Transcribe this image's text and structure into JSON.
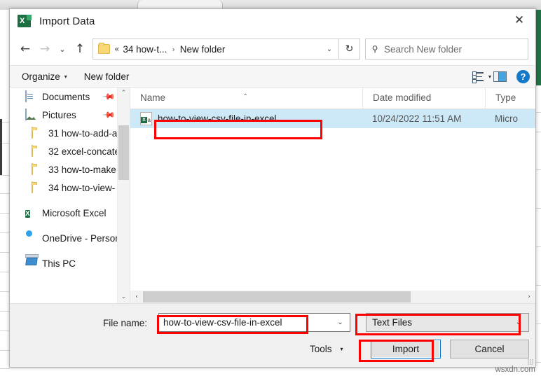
{
  "window": {
    "title": "Import Data",
    "app_icon": "excel-icon",
    "close_label": "✕"
  },
  "nav": {
    "back": "←",
    "forward": "→",
    "recent": "⌄",
    "up": "↑",
    "refresh": "↻",
    "address": {
      "overflow": "«",
      "segments": [
        "34 how-t...",
        "New folder"
      ],
      "separator": "›",
      "dropdown": "⌄"
    },
    "search": {
      "icon": "search-icon",
      "placeholder": "Search New folder"
    }
  },
  "toolbar": {
    "organize": "Organize",
    "organize_caret": "▾",
    "new_folder": "New folder",
    "view_caret": "▾",
    "help": "?"
  },
  "sidebar": {
    "scroll_up": "⌃",
    "scroll_down": "⌄",
    "items": [
      {
        "label": "Documents",
        "icon": "documents-icon",
        "pinned": true,
        "indent": false
      },
      {
        "label": "Pictures",
        "icon": "pictures-icon",
        "pinned": true,
        "indent": false
      },
      {
        "label": "31 how-to-add-a",
        "icon": "folder-icon",
        "pinned": false,
        "indent": true
      },
      {
        "label": "32 excel-concate",
        "icon": "folder-icon",
        "pinned": false,
        "indent": true
      },
      {
        "label": "33 how-to-make",
        "icon": "folder-icon",
        "pinned": false,
        "indent": true
      },
      {
        "label": "34 how-to-view-",
        "icon": "folder-icon",
        "pinned": false,
        "indent": true
      },
      {
        "label": "Microsoft Excel",
        "icon": "excel-icon",
        "pinned": false,
        "indent": false
      },
      {
        "label": "OneDrive - Person",
        "icon": "onedrive-icon",
        "pinned": false,
        "indent": false
      },
      {
        "label": "This PC",
        "icon": "this-pc-icon",
        "pinned": false,
        "indent": false
      }
    ]
  },
  "filelist": {
    "columns": [
      "Name",
      "Date modified",
      "Type"
    ],
    "sort_indicator": "⌃",
    "rows": [
      {
        "name": "how-to-view-csv-file-in-excel",
        "date_modified": "10/24/2022 11:51 AM",
        "type": "Micro",
        "selected": true,
        "icon": "csv-excel-file-icon"
      }
    ],
    "hscroll_left": "‹",
    "hscroll_right": "›"
  },
  "footer": {
    "filename_label": "File name:",
    "filename_value": "how-to-view-csv-file-in-excel",
    "filename_placeholder": "File name",
    "filename_caret": "⌄",
    "filetype_value": "Text Files",
    "filetype_caret": "⌄",
    "tools_label": "Tools",
    "tools_caret": "▾",
    "import_label": "Import",
    "cancel_label": "Cancel"
  },
  "annotations": {
    "highlight_color": "#ff0000",
    "boxes": [
      "selected-file-row",
      "file-name-field",
      "file-type-combo",
      "import-button"
    ]
  },
  "watermark": "wsxdn.com"
}
